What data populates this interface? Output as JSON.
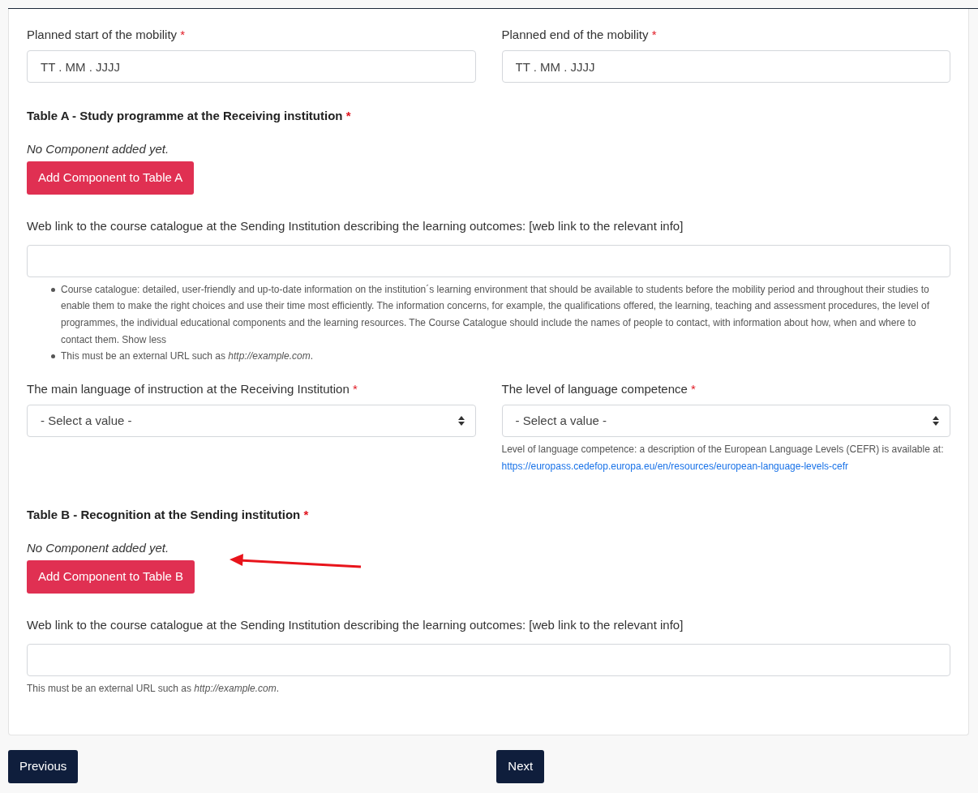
{
  "dates": [
    {
      "label": "Planned start of the mobility",
      "required_mark": "*",
      "placeholder": "TT . MM . JJJJ"
    },
    {
      "label": "Planned end of the mobility",
      "required_mark": "*",
      "placeholder": "TT . MM . JJJJ"
    }
  ],
  "table_a": {
    "heading": "Table A - Study programme at the Receiving institution",
    "required_mark": "*",
    "empty_note": "No Component added yet.",
    "add_button": "Add Component to Table A",
    "marked": false
  },
  "link_a": {
    "label": "Web link to the course catalogue at the Sending Institution describing the learning outcomes: [web link to the relevant info]",
    "help_items": [
      "Course catalogue: detailed, user-friendly and up-to-date information on the institution´s learning environment that should be available to students before the mobility period and throughout their studies to enable them to make the right choices and use their time most efficiently. The information concerns, for example, the qualifications offered, the learning, teaching and assessment procedures, the level of programmes, the individual educational components and the learning resources. The Course Catalogue should include the names of people to contact, with information about how, when and where to contact them. Show less",
      "This must be an external URL such as *http://example.com*."
    ]
  },
  "languages": [
    {
      "label": "The main language of instruction at the Receiving Institution",
      "required_mark": "*",
      "placeholder": "- Select a value -"
    },
    {
      "label": "The level of language competence",
      "required_mark": "*",
      "placeholder": "- Select a value -",
      "help": "Level of language competence: a description of the European Language Levels (CEFR) is available at:",
      "help_link": "https://europass.cedefop.europa.eu/en/resources/european-language-levels-cefr"
    }
  ],
  "table_b": {
    "heading": "Table B - Recognition at the Sending institution",
    "required_mark": "*",
    "empty_note": "No Component added yet.",
    "add_button": "Add Component to Table B",
    "marked": true
  },
  "link_b": {
    "label": "Web link to the course catalogue at the Sending Institution describing the learning outcomes: [web link to the relevant info]",
    "help": "This must be an external URL such as *http://example.com*."
  },
  "nav_buttons": [
    {
      "kind": "previous",
      "label": "Previous"
    },
    {
      "kind": "next",
      "label": "Next"
    }
  ]
}
